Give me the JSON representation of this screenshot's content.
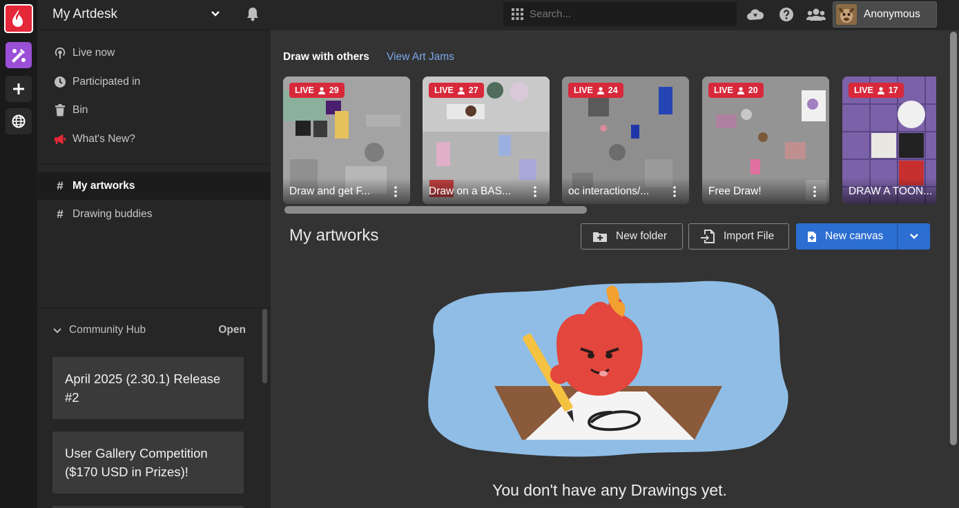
{
  "app": {
    "workspace_title": "My Artdesk",
    "rail": [
      "flame-logo-icon",
      "palette-apps-icon",
      "plus-icon",
      "globe-icon"
    ],
    "accent_color": "#e5273a"
  },
  "sidebar": {
    "nav": [
      {
        "label": "Live now",
        "icon": "live-icon"
      },
      {
        "label": "Participated in",
        "icon": "clock-icon"
      },
      {
        "label": "Bin",
        "icon": "trash-icon"
      },
      {
        "label": "What's New?",
        "icon": "megaphone-icon"
      }
    ],
    "channels": [
      {
        "label": "My artworks",
        "active": true
      },
      {
        "label": "Drawing buddies",
        "active": false
      }
    ],
    "community_hub": {
      "label": "Community Hub",
      "action": "Open",
      "posts": [
        "April 2025 (2.30.1) Release #2",
        "User Gallery Competition ($170 USD in Prizes)!"
      ]
    }
  },
  "topbar": {
    "search_placeholder": "Search...",
    "icons": [
      "cloud-icon",
      "help-icon",
      "friends-icon"
    ],
    "user": {
      "name": "Anonymous"
    }
  },
  "main": {
    "draw_with_others": "Draw with others",
    "view_art_jams": "View Art Jams",
    "live_label": "LIVE",
    "jams": [
      {
        "title": "Draw and get F...",
        "count": "29"
      },
      {
        "title": "Draw on a BAS...",
        "count": "27"
      },
      {
        "title": "oc interactions/...",
        "count": "24"
      },
      {
        "title": "Free Draw!",
        "count": "20"
      },
      {
        "title": "DRAW A TOON...",
        "count": "17"
      }
    ],
    "section_title": "My artworks",
    "buttons": {
      "new_folder": "New folder",
      "import_file": "Import File",
      "new_canvas": "New canvas"
    },
    "empty_state": "You don't have any Drawings yet.",
    "colors": {
      "primary_button": "#2c6ed2",
      "live_badge": "#d8293b",
      "splash": "#8fbde6"
    }
  }
}
